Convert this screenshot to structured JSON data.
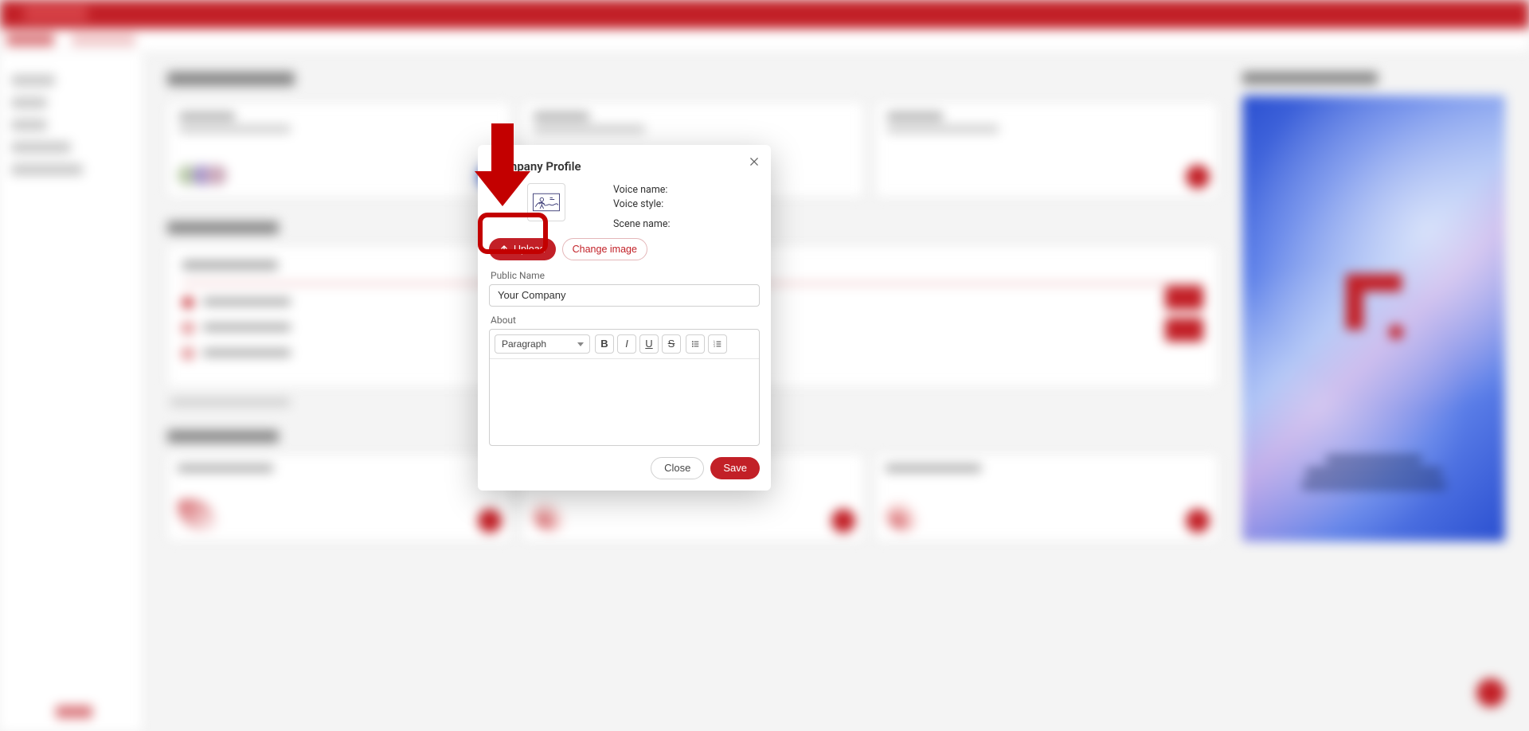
{
  "modal": {
    "title": "Company Profile",
    "voice_name_label": "Voice name:",
    "voice_style_label": "Voice style:",
    "scene_name_label": "Scene name:",
    "upload_label": "Upload",
    "change_image_label": "Change image",
    "public_name_label": "Public Name",
    "public_name_value": "Your Company",
    "about_label": "About",
    "format_option": "Paragraph",
    "close_label": "Close",
    "save_label": "Save"
  },
  "colors": {
    "brand": "#c22027",
    "annotation": "#c30000"
  }
}
